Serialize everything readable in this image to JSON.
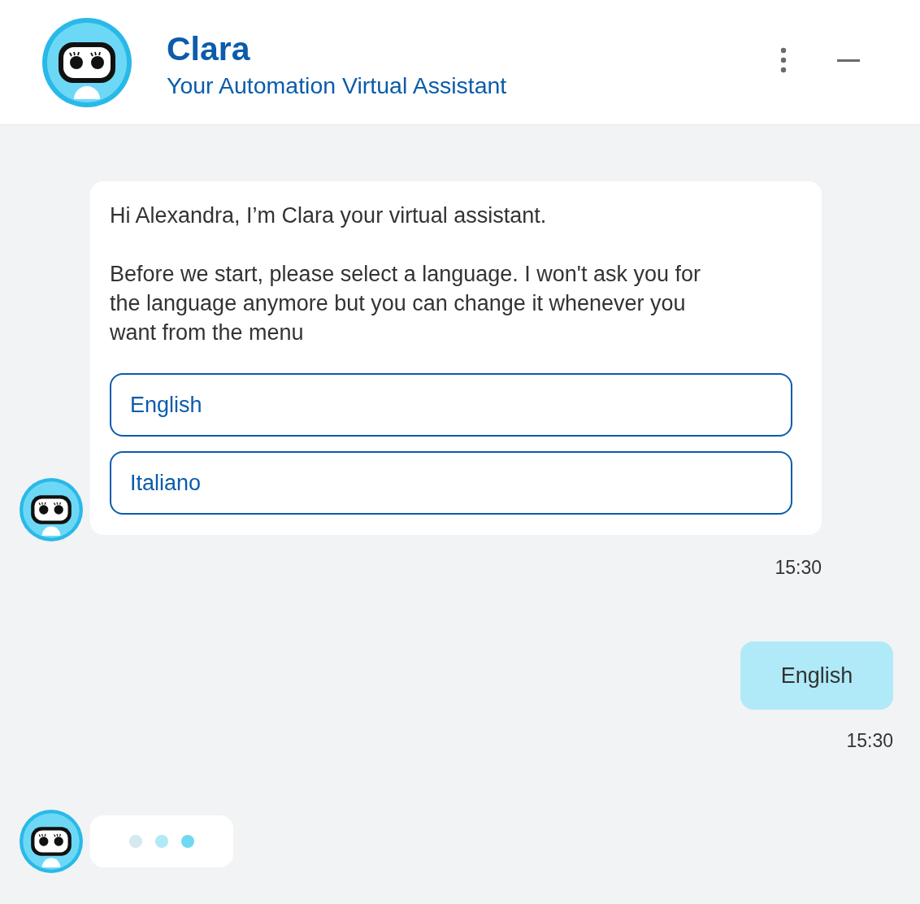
{
  "header": {
    "title": "Clara",
    "subtitle": "Your Automation Virtual Assistant"
  },
  "messages": [
    {
      "kind": "bot",
      "paragraphs": [
        "Hi Alexandra, I’m Clara your virtual assistant.",
        "Before we start, please select a language. I won't ask you for the language anymore but you can change it whenever you want from the menu"
      ],
      "options": [
        "English",
        "Italiano"
      ],
      "time": "15:30"
    },
    {
      "kind": "user",
      "text": "English",
      "time": "15:30"
    },
    {
      "kind": "typing",
      "dots": [
        {
          "color": "#d5e9ef"
        },
        {
          "color": "#b1e9f7"
        },
        {
          "color": "#6fd9f2"
        }
      ]
    }
  ]
}
